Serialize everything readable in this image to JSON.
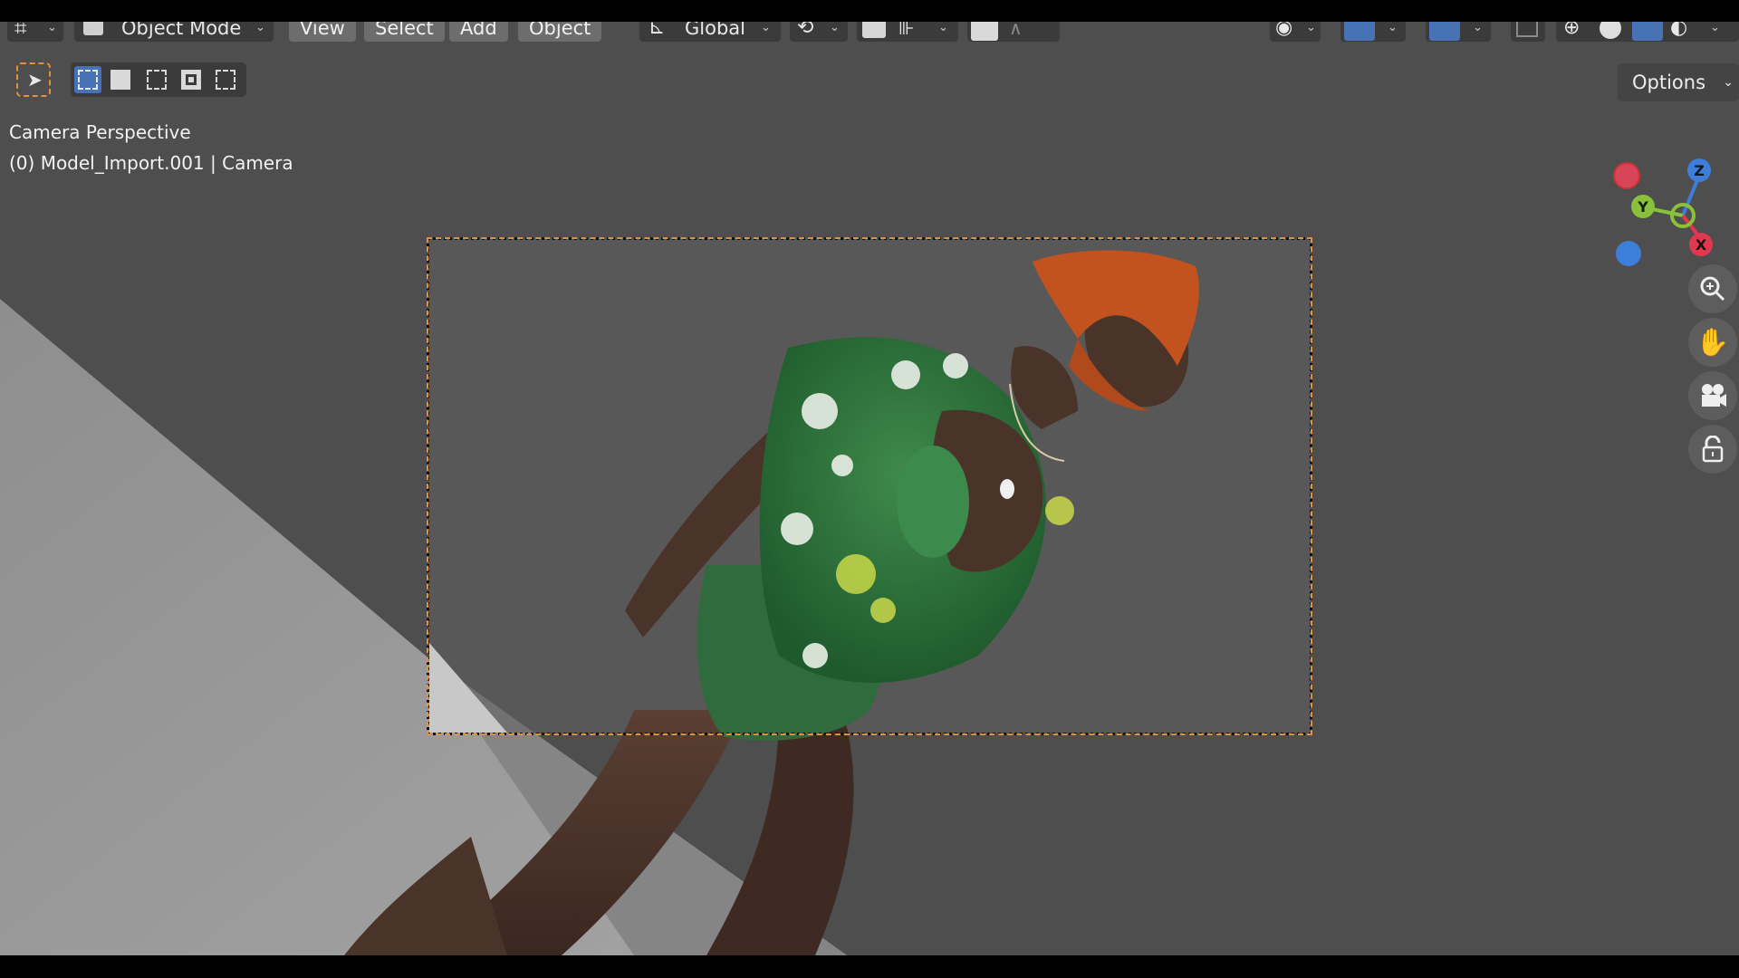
{
  "header": {
    "mode_label": "Object Mode",
    "menus": [
      "View",
      "Select",
      "Add",
      "Object"
    ],
    "orientation_label": "Global",
    "options_label": "Options"
  },
  "viewport": {
    "perspective_label": "Camera Perspective",
    "object_label": "(0) Model_Import.001 | Camera"
  },
  "gizmo": {
    "axes": [
      {
        "label": "Z",
        "color": "#3d7edb"
      },
      {
        "label": "Y",
        "color": "#8ac13a"
      },
      {
        "label": "X",
        "color": "#e0384f"
      }
    ]
  },
  "nav_buttons": [
    "zoom-icon",
    "hand-icon",
    "camera-icon",
    "lock-icon"
  ],
  "colors": {
    "viewport_bg": "#4e4e4e",
    "floor": "#9a9a9a",
    "accent_blue": "#4772b3",
    "camera_frame_orange": "#e0913a"
  }
}
